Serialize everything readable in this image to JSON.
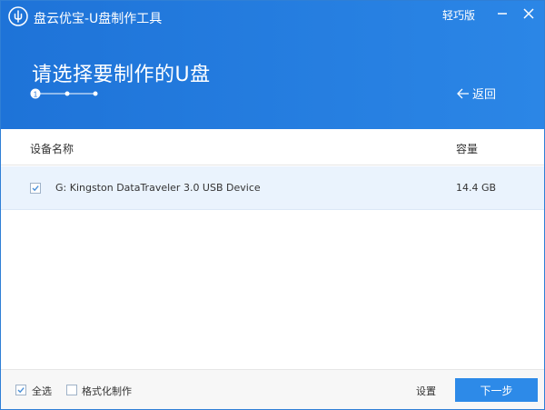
{
  "header": {
    "app_title": "盘云优宝-U盘制作工具",
    "edition": "轻巧版",
    "step_title": "请选择要制作的U盘",
    "current_step": "1",
    "back_label": "返回"
  },
  "table": {
    "columns": [
      "设备名称",
      "容量"
    ],
    "rows": [
      {
        "name": "G: Kingston DataTraveler 3.0 USB Device",
        "capacity": "14.4 GB",
        "checked": true
      }
    ]
  },
  "footer": {
    "select_all_label": "全选",
    "format_label": "格式化制作",
    "settings_label": "设置",
    "next_label": "下一步"
  },
  "colors": {
    "header_bg": "#2b86e6",
    "accent": "#2d8ae8",
    "row_selected": "#eaf3fd"
  },
  "icons": [
    "usb-logo-icon",
    "minimize-icon",
    "close-icon",
    "back-arrow-icon",
    "checkbox-checked-icon"
  ]
}
